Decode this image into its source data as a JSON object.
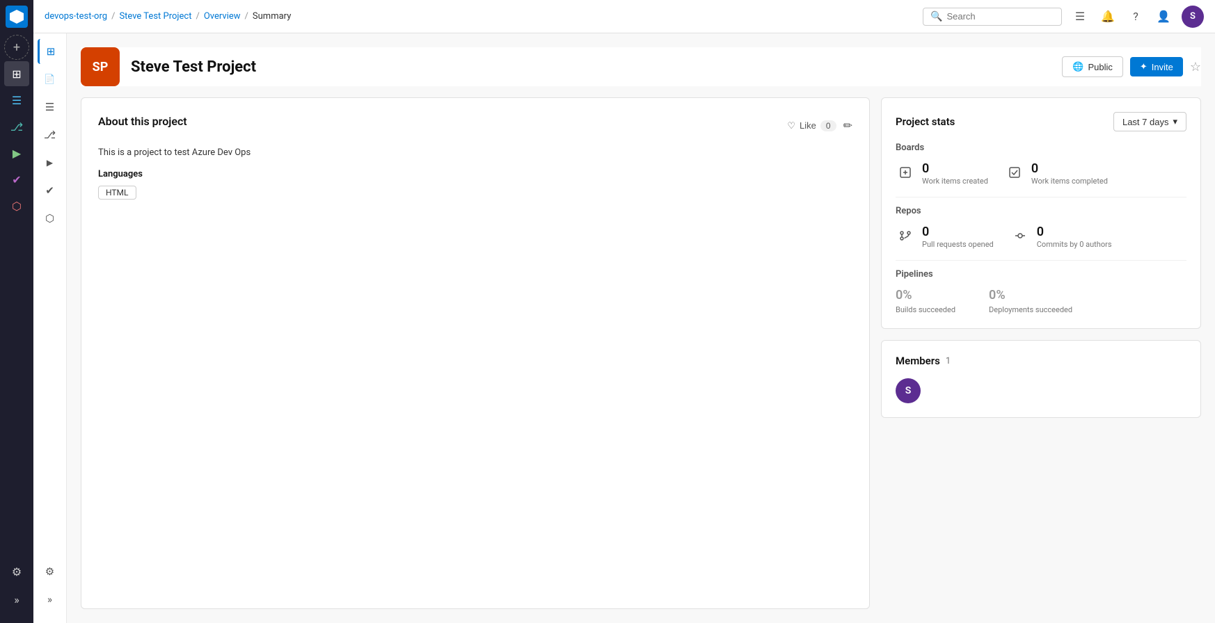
{
  "app": {
    "logo_label": "Azure DevOps"
  },
  "sidebar": {
    "icons": [
      {
        "name": "overview-icon",
        "symbol": "⊞",
        "active": true
      },
      {
        "name": "boards-icon",
        "symbol": "☰"
      },
      {
        "name": "repos-icon",
        "symbol": "⎇"
      },
      {
        "name": "pipelines-icon",
        "symbol": "▶"
      },
      {
        "name": "testplans-icon",
        "symbol": "✔"
      },
      {
        "name": "artifacts-icon",
        "symbol": "⬡"
      }
    ]
  },
  "top_nav": {
    "breadcrumbs": [
      {
        "label": "devops-test-org",
        "link": true
      },
      {
        "label": "Steve Test Project",
        "link": true
      },
      {
        "label": "Overview",
        "link": true
      },
      {
        "label": "Summary",
        "link": false
      }
    ],
    "search_placeholder": "Search",
    "user_initials": "S"
  },
  "project_header": {
    "avatar_text": "SP",
    "avatar_bg": "#d44000",
    "name": "Steve Test Project",
    "visibility": "Public",
    "invite_label": "Invite",
    "star_symbol": "☆"
  },
  "about": {
    "title": "About this project",
    "like_label": "Like",
    "like_count": "0",
    "description": "This is a project to test Azure Dev Ops",
    "languages_label": "Languages",
    "languages": [
      "HTML"
    ]
  },
  "project_stats": {
    "title": "Project stats",
    "period_label": "Last 7 days",
    "boards": {
      "section_title": "Boards",
      "work_items_created": "0",
      "work_items_created_label": "Work items created",
      "work_items_completed": "0",
      "work_items_completed_label": "Work items completed"
    },
    "repos": {
      "section_title": "Repos",
      "pull_requests": "0",
      "pull_requests_label": "Pull requests opened",
      "commits": "0",
      "commits_label": "Commits by 0 authors"
    },
    "pipelines": {
      "section_title": "Pipelines",
      "builds_pct": "0%",
      "builds_label": "Builds succeeded",
      "deployments_pct": "0%",
      "deployments_label": "Deployments succeeded"
    }
  },
  "members": {
    "title": "Members",
    "count": "1",
    "list": [
      {
        "initials": "S",
        "bg": "#5c2d91"
      }
    ]
  },
  "left_nav": {
    "icons": [
      {
        "name": "summary-icon",
        "symbol": "⊞",
        "active": true
      },
      {
        "name": "wiki-icon",
        "symbol": "📄"
      },
      {
        "name": "boards-left-icon",
        "symbol": "☰"
      },
      {
        "name": "repos-left-icon",
        "symbol": "⎇"
      },
      {
        "name": "pipelines-left-icon",
        "symbol": "▶"
      },
      {
        "name": "testplans-left-icon",
        "symbol": "✔"
      },
      {
        "name": "artifacts-left-icon",
        "symbol": "⬡"
      }
    ],
    "settings_icon": "⚙",
    "expand_icon": "»"
  }
}
